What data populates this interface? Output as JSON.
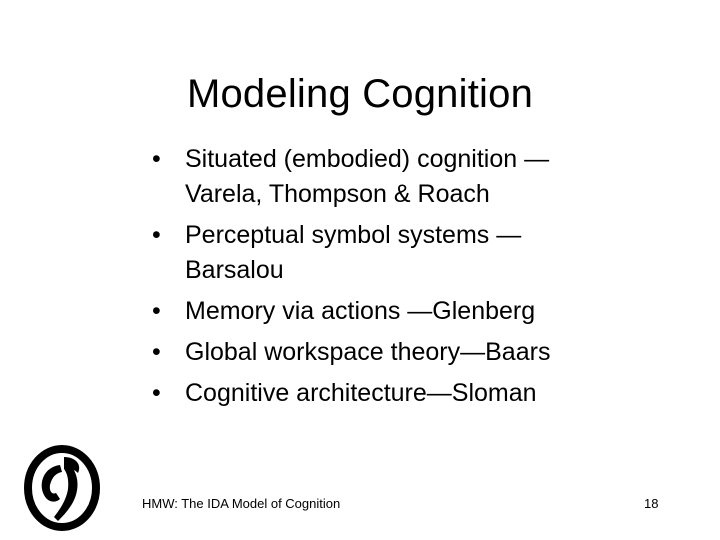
{
  "slide": {
    "title": "Modeling Cognition",
    "bullet_char": "•",
    "bullets": [
      {
        "lines": [
          "Situated (embodied) cognition —",
          "Varela, Thompson & Roach"
        ]
      },
      {
        "lines": [
          "Perceptual symbol systems —",
          "Barsalou"
        ]
      },
      {
        "lines": [
          "Memory via actions —Glenberg"
        ]
      },
      {
        "lines": [
          "Global workspace theory—Baars"
        ]
      },
      {
        "lines": [
          "Cognitive architecture—Sloman"
        ]
      }
    ],
    "footer": "HMW: The IDA Model of Cognition",
    "page_number": "18",
    "logo_icon": "memphis-logo-icon"
  }
}
